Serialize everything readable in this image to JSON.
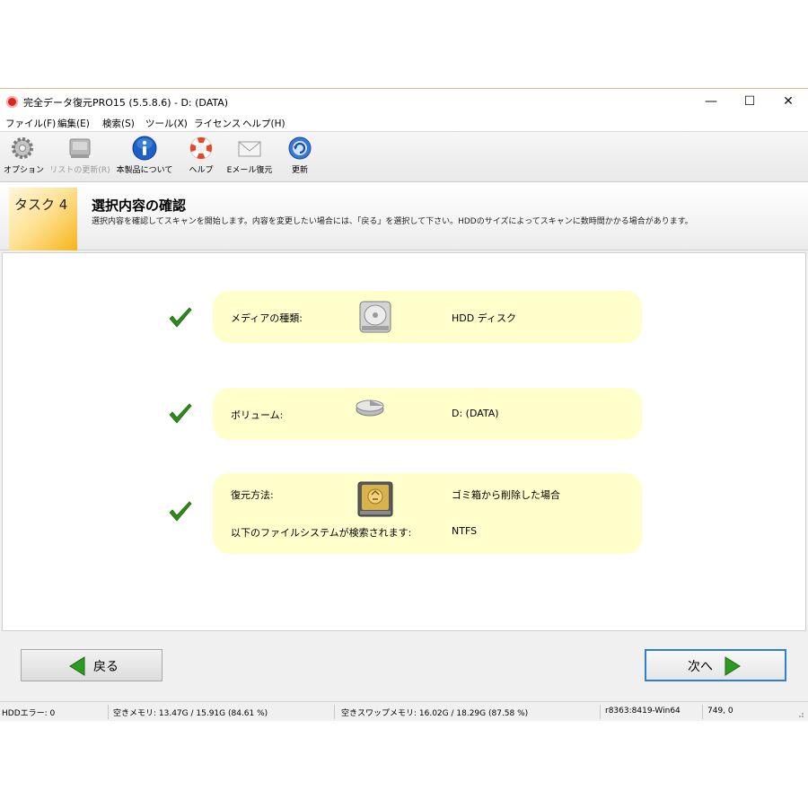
{
  "window": {
    "title": "完全データ復元PRO15 (5.5.8.6) - D: (DATA)",
    "minimize": "—",
    "maximize": "☐",
    "close": "✕"
  },
  "menu": [
    "ファイル(F)",
    "編集(E)",
    "検索(S)",
    "ツール(X)",
    "ライセンス",
    "ヘルプ(H)"
  ],
  "toolbar": {
    "options": "オプション",
    "refresh_list": "リストの更新(R)",
    "about": "本製品について",
    "help": "ヘルプ",
    "email_recovery": "Eメール復元",
    "update": "更新"
  },
  "task": {
    "number": "タスク 4",
    "title": "選択内容の確認",
    "description": "選択内容を確認してスキャンを開始します。内容を変更したい場合には、「戻る」を選択して下さい。HDDのサイズによってスキャンに数時間かかる場合があります。"
  },
  "summary": {
    "media_label": "メディアの種類:",
    "media_value": "HDD ディスク",
    "volume_label": "ボリューム:",
    "volume_value": "D: (DATA)",
    "method_label": "復元方法:",
    "method_value": "ゴミ箱から削除した場合",
    "fs_label": "以下のファイルシステムが検索されます:",
    "fs_value": "NTFS"
  },
  "buttons": {
    "back": "戻る",
    "next": "次へ"
  },
  "status": {
    "hdd_errors": "HDDエラー: 0",
    "free_memory": "空きメモリ: 13.47G / 15.91G (84.61 %)",
    "free_swap": "空きスワップメモリ: 16.02G / 18.29G (87.58 %)",
    "build": "r8363:8419-Win64",
    "coords": "749, 0"
  },
  "colors": {
    "accent": "#2f7fd0",
    "pill": "#ffffcc",
    "check": "#2e8b1a",
    "task_tab": "#f6b51a"
  }
}
